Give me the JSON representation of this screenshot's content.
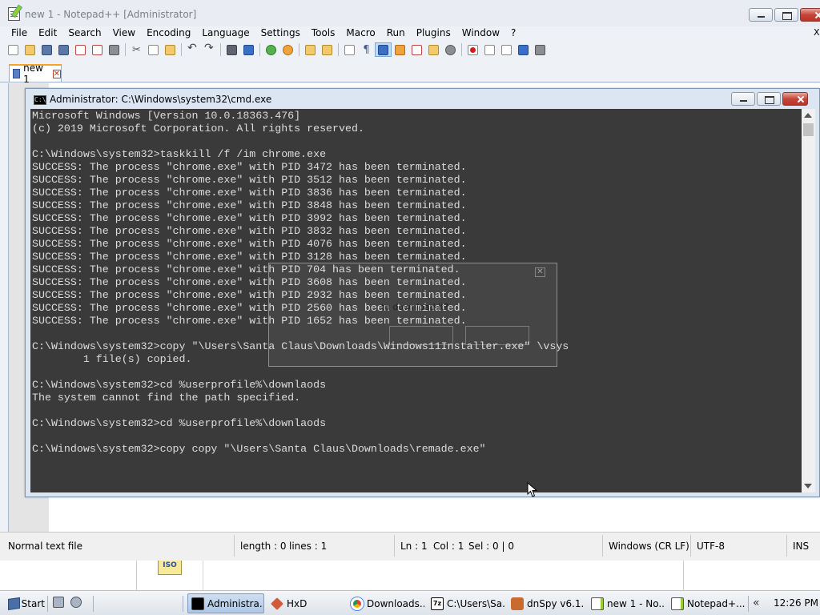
{
  "npp": {
    "title": "new 1 - Notepad++ [Administrator]",
    "menu": [
      "File",
      "Edit",
      "Search",
      "View",
      "Encoding",
      "Language",
      "Settings",
      "Tools",
      "Macro",
      "Run",
      "Plugins",
      "Window",
      "?"
    ],
    "menu_close": "X",
    "tab": {
      "label": "new 1",
      "close": "✕"
    },
    "status": {
      "file_type": "Normal text file",
      "length": "length : 0",
      "lines": "lines : 1",
      "ln": "Ln : 1",
      "col": "Col : 1",
      "sel": "Sel : 0 | 0",
      "eol": "Windows (CR LF)",
      "encoding": "UTF-8",
      "mode": "INS"
    }
  },
  "background_window": {
    "icon_text": "ISO"
  },
  "cmd": {
    "title": "Administrator: C:\\Windows\\system32\\cmd.exe",
    "icon_text": "C:\\",
    "lines": [
      "Microsoft Windows [Version 10.0.18363.476]",
      "(c) 2019 Microsoft Corporation. All rights reserved.",
      "",
      "C:\\Windows\\system32>taskkill /f /im chrome.exe",
      "SUCCESS: The process \"chrome.exe\" with PID 3472 has been terminated.",
      "SUCCESS: The process \"chrome.exe\" with PID 3512 has been terminated.",
      "SUCCESS: The process \"chrome.exe\" with PID 3836 has been terminated.",
      "SUCCESS: The process \"chrome.exe\" with PID 3848 has been terminated.",
      "SUCCESS: The process \"chrome.exe\" with PID 3992 has been terminated.",
      "SUCCESS: The process \"chrome.exe\" with PID 3832 has been terminated.",
      "SUCCESS: The process \"chrome.exe\" with PID 4076 has been terminated.",
      "SUCCESS: The process \"chrome.exe\" with PID 3128 has been terminated.",
      "SUCCESS: The process \"chrome.exe\" with PID 704 has been terminated.",
      "SUCCESS: The process \"chrome.exe\" with PID 3608 has been terminated.",
      "SUCCESS: The process \"chrome.exe\" with PID 2932 has been terminated.",
      "SUCCESS: The process \"chrome.exe\" with PID 2560 has been terminated.",
      "SUCCESS: The process \"chrome.exe\" with PID 1652 has been terminated.",
      "",
      "C:\\Windows\\system32>copy \"\\Users\\Santa Claus\\Downloads\\Windows11Installer.exe\" \\vsys",
      "        1 file(s) copied.",
      "",
      "C:\\Windows\\system32>cd %userprofile%\\downlaods",
      "The system cannot find the path specified.",
      "",
      "C:\\Windows\\system32>cd %userprofile%\\downlaods",
      "",
      "C:\\Windows\\system32>copy copy \"\\Users\\Santa Claus\\Downloads\\remade.exe\""
    ]
  },
  "ghost_dialog": {
    "text": "to download it?",
    "close": "✕"
  },
  "taskbar": {
    "start": "Start",
    "items": [
      {
        "label": "Administra...",
        "icon": "cmd-icon",
        "active": true
      },
      {
        "label": "HxD",
        "icon": "hxd-icon",
        "active": false
      },
      {
        "label": "Downloads...",
        "icon": "chrome-icon",
        "active": false
      },
      {
        "label": "C:\\Users\\Sa...",
        "icon": "7zip-icon",
        "active": false
      },
      {
        "label": "dnSpy v6.1....",
        "icon": "dnspy-icon",
        "active": false
      },
      {
        "label": "new 1 - No...",
        "icon": "notepadpp-icon",
        "active": false
      },
      {
        "label": "Notepad+...",
        "icon": "notepadpp-icon",
        "active": false
      }
    ],
    "tray_chevron": "«",
    "clock": "12:26 PM"
  }
}
